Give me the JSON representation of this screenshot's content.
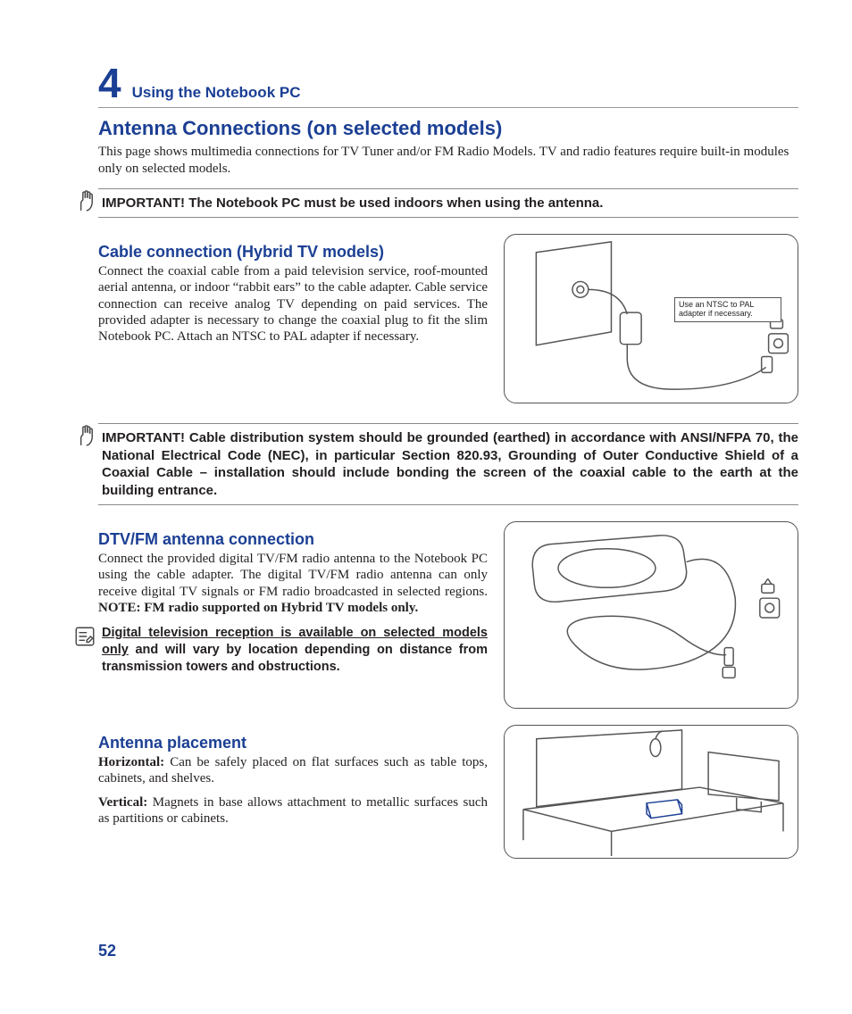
{
  "chapter": {
    "number": "4",
    "title": "Using the Notebook PC"
  },
  "h1": "Antenna Connections (on selected models)",
  "intro": "This page shows multimedia connections for TV Tuner and/or FM Radio Models. TV and radio features require built-in modules only on selected models.",
  "important1": "IMPORTANT! The Notebook PC must be used indoors when using the antenna.",
  "cable": {
    "heading": "Cable connection (Hybrid TV models)",
    "body": "Connect the coaxial cable from a paid television service, roof-mounted aerial antenna, or indoor “rabbit ears” to the cable adapter. Cable service connection can receive analog TV depending on paid services. The provided adapter is necessary to change the coaxial plug to fit the slim Notebook PC. Attach an NTSC to PAL adapter if necessary.",
    "fig_label": "Use an NTSC to PAL adapter if necessary."
  },
  "important2": "IMPORTANT!  Cable distribution system should be grounded (earthed) in accordance with ANSI/NFPA 70, the National Electrical Code (NEC), in particular Section 820.93, Grounding of Outer Conductive Shield of a Coaxial Cable – installation should include bonding the screen of the coaxial cable to the earth at the building entrance.",
  "dtv": {
    "heading": "DTV/FM antenna connection",
    "body_plain": "Connect the provided digital TV/FM radio antenna to the Notebook PC using the cable adapter. The digital TV/FM radio antenna can only receive digital TV signals or FM radio broadcasted in selected regions. ",
    "body_bold": "NOTE: FM radio supported on Hybrid TV models only.",
    "note_ul": "Digital television reception is available on selected models only",
    "note_rest": " and will vary by location depending on distance from transmission towers and obstructions."
  },
  "placement": {
    "heading": "Antenna placement",
    "h_label": "Horizontal:",
    "h_body": " Can be safely placed on flat surfaces such as table tops, cabinets, and shelves.",
    "v_label": "Vertical:",
    "v_body": " Magnets in base allows attachment to metallic surfaces such as partitions or cabinets."
  },
  "page_number": "52"
}
